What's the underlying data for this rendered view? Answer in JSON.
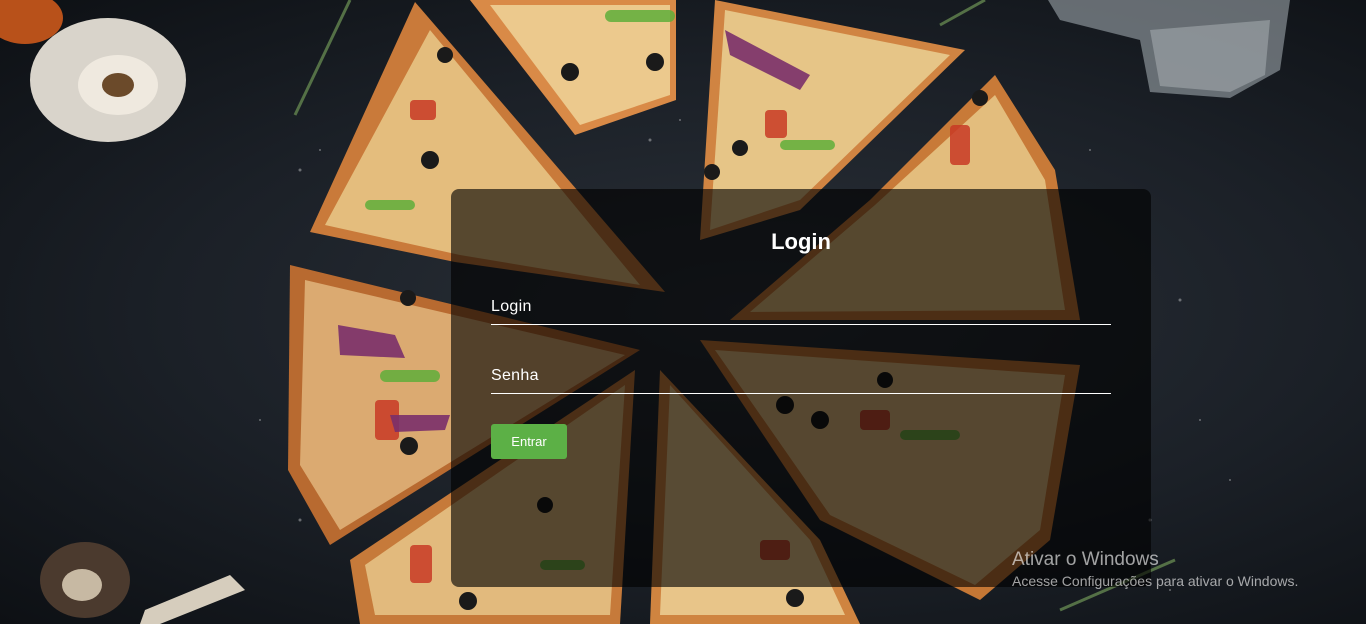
{
  "login_card": {
    "title": "Login",
    "login_placeholder": "Login",
    "password_placeholder": "Senha",
    "submit_label": "Entrar"
  },
  "windows_watermark": {
    "title": "Ativar o Windows",
    "subtitle": "Acesse Configurações para ativar o Windows."
  },
  "colors": {
    "background": "#1b2027",
    "card_overlay": "rgba(0,0,0,0.62)",
    "button": "#5cb046",
    "text": "#ffffff"
  }
}
